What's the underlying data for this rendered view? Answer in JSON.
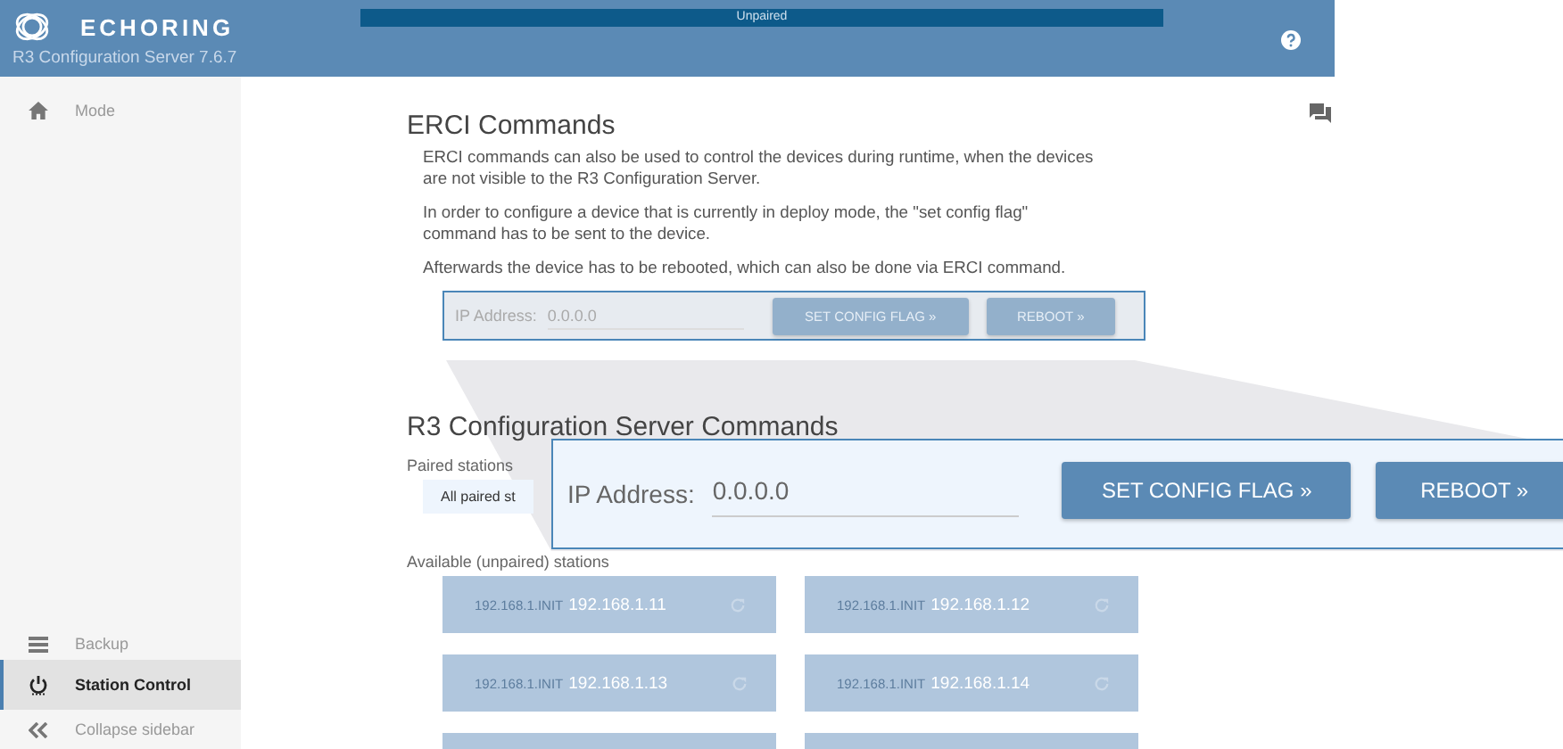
{
  "header": {
    "brand": "ECHORING",
    "version": "R3 Configuration Server 7.6.7",
    "status": "Unpaired"
  },
  "sidebar": {
    "top_items": [
      {
        "label": "Mode",
        "selected": false
      }
    ],
    "bottom_items": [
      {
        "label": "Backup",
        "selected": false
      },
      {
        "label": "Station Control",
        "selected": true
      }
    ],
    "collapse_label": "Collapse sidebar"
  },
  "erci": {
    "title": "ERCI Commands",
    "paragraphs": [
      "ERCI commands can also be used to control the devices during runtime, when the devices are not visible to the R3 Configuration Server.",
      "In order to configure a device that is currently in deploy mode, the \"set config flag\" command has to be sent to the device.",
      "Afterwards the device has to be rebooted, which can also be done via ERCI command."
    ],
    "panel": {
      "ip_label": "IP Address:",
      "ip_value": "0.0.0.0",
      "buttons": [
        "SET CONFIG FLAG »",
        "REBOOT »"
      ],
      "disabled": true
    }
  },
  "r3": {
    "title": "R3 Configuration Server Commands",
    "paired_label": "Paired stations",
    "paired_button": "All paired st",
    "available_label": "Available (unpaired) stations",
    "stations": [
      {
        "name": "192.168.1.INIT",
        "ip": "192.168.1.11"
      },
      {
        "name": "192.168.1.INIT",
        "ip": "192.168.1.12"
      },
      {
        "name": "192.168.1.INIT",
        "ip": "192.168.1.13"
      },
      {
        "name": "192.168.1.INIT",
        "ip": "192.168.1.14"
      }
    ]
  },
  "zoom_callout": {
    "ip_label": "IP Address:",
    "ip_value": "0.0.0.0",
    "buttons": [
      "SET CONFIG FLAG »",
      "REBOOT »"
    ],
    "disabled": false
  }
}
